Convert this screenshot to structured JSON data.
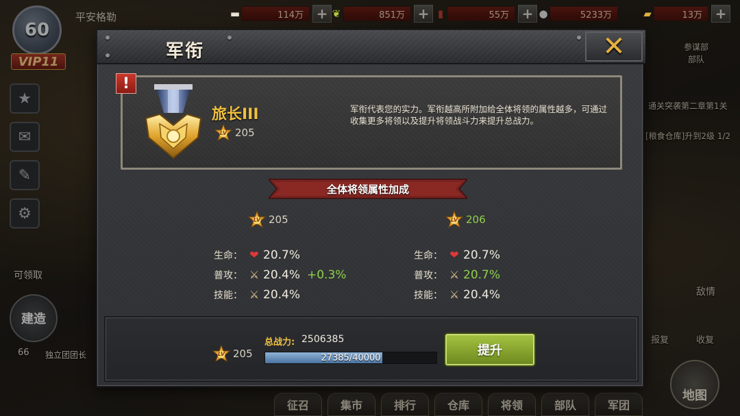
{
  "background": {
    "player": {
      "level": "60",
      "vip": "VIP11",
      "name": "平安格勒"
    },
    "resources": [
      {
        "icon": "silver-icon",
        "value": "114万"
      },
      {
        "icon": "grain-icon",
        "value": "851万"
      },
      {
        "icon": "oil-icon",
        "value": "55万"
      },
      {
        "icon": "coin-icon",
        "value": "5233万"
      },
      {
        "icon": "gold-icon",
        "value": "13万"
      }
    ],
    "side_labels": {
      "claimable": "可领取",
      "build": "建造",
      "level_66": "66",
      "unit": "独立团团长"
    },
    "right_panel": {
      "hq": "参谋部",
      "hq_sub": "部队",
      "quest1": "通关突袭第二章第1关",
      "quest2": "[粮食仓库]升到2级 1/2",
      "intel": "敌情",
      "recover": "收复",
      "grudge": "报复"
    },
    "nav": [
      "征召",
      "集市",
      "排行",
      "仓库",
      "将领",
      "部队",
      "军团"
    ],
    "map_label": "地图"
  },
  "modal": {
    "title": "军衔",
    "close_glyph": "✕",
    "rank": {
      "alert": "!",
      "name": "旅长III",
      "level": "205",
      "description": "军衔代表您的实力。军衔越高所附加给全体将领的属性越多，可通过收集更多将领以及提升将领战斗力来提升总战力。"
    },
    "section_title": "全体将领属性加成",
    "lv_badge_text": "LV",
    "current": {
      "level": "205",
      "stats": [
        {
          "label": "生命：",
          "icon": "heart-icon",
          "value": "20.7%",
          "bonus": ""
        },
        {
          "label": "普攻：",
          "icon": "sword-icon",
          "value": "20.4%",
          "bonus": "+0.3%"
        },
        {
          "label": "技能：",
          "icon": "sword-icon",
          "value": "20.4%",
          "bonus": ""
        }
      ]
    },
    "next": {
      "level": "206",
      "stats": [
        {
          "label": "生命：",
          "icon": "heart-icon",
          "value": "20.7%"
        },
        {
          "label": "普攻：",
          "icon": "sword-icon",
          "value": "20.7%"
        },
        {
          "label": "技能：",
          "icon": "sword-icon",
          "value": "20.4%"
        }
      ]
    },
    "footer": {
      "level": "205",
      "power_label": "总战力:",
      "power_value": "2506385",
      "xp_text": "27385/40000",
      "xp_fraction": 0.6846,
      "upgrade_label": "提升"
    },
    "colors": {
      "gold": "#f0c040",
      "green": "#8ed24a",
      "xp": "#6a93c0"
    }
  }
}
